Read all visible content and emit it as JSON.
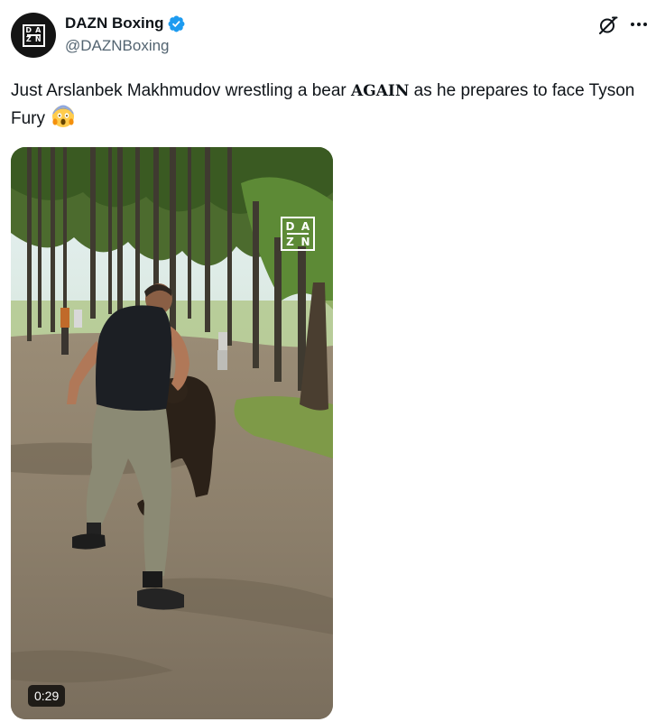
{
  "author": {
    "display_name": "DAZN Boxing",
    "handle": "@DAZNBoxing",
    "verified": true,
    "avatar_logo": {
      "top_left": "D",
      "top_right": "A",
      "bottom_left": "Z",
      "bottom_right": "N"
    }
  },
  "header_actions": {
    "grok_icon": "grok-icon",
    "more_icon": "more-icon"
  },
  "tweet": {
    "text_before": "Just Arslanbek Makhmudov wrestling a bear ",
    "text_emphasis": "AGAIN",
    "text_after": " as he prepares to face Tyson Fury",
    "emoji": "😱"
  },
  "video": {
    "duration": "0:29",
    "watermark": {
      "top_left": "D",
      "top_right": "A",
      "bottom_left": "Z",
      "bottom_right": "N"
    }
  },
  "colors": {
    "verified_blue": "#1d9bf0",
    "text_primary": "#0f1419",
    "text_secondary": "#536471"
  }
}
